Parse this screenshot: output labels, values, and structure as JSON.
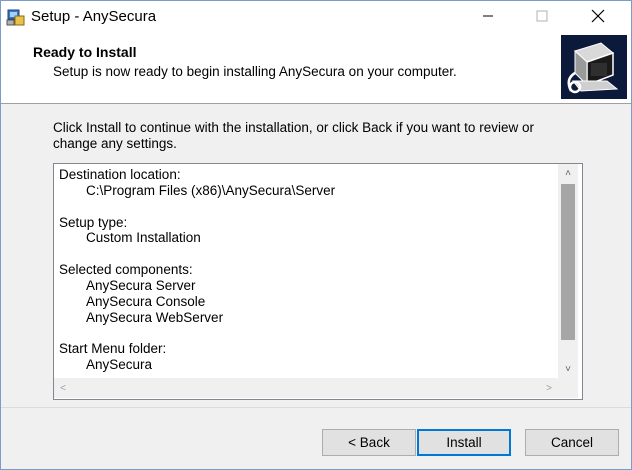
{
  "window": {
    "title": "Setup - AnySecura",
    "controls": {
      "minimize": "minimize-icon",
      "maximize": "maximize-icon",
      "close": "close-icon"
    }
  },
  "header": {
    "title": "Ready to Install",
    "subtitle": "Setup is now ready to begin installing AnySecura on your computer."
  },
  "instructions": "Click Install to continue with the installation, or click Back if you want to review or change any settings.",
  "memo": {
    "lines": [
      {
        "text": "Destination location:",
        "indent": false
      },
      {
        "text": "C:\\Program Files (x86)\\AnySecura\\Server",
        "indent": true
      },
      {
        "text": "",
        "indent": false
      },
      {
        "text": "Setup type:",
        "indent": false
      },
      {
        "text": "Custom Installation",
        "indent": true
      },
      {
        "text": "",
        "indent": false
      },
      {
        "text": "Selected components:",
        "indent": false
      },
      {
        "text": "AnySecura Server",
        "indent": true
      },
      {
        "text": "AnySecura Console",
        "indent": true
      },
      {
        "text": "AnySecura WebServer",
        "indent": true
      },
      {
        "text": "",
        "indent": false
      },
      {
        "text": "Start Menu folder:",
        "indent": false
      },
      {
        "text": "AnySecura",
        "indent": true
      }
    ]
  },
  "buttons": {
    "back": "< Back",
    "install": "Install",
    "cancel": "Cancel"
  },
  "colors": {
    "focus_border": "#0078d7",
    "header_bg": "#ffffff",
    "body_bg": "#f0f0f0"
  }
}
